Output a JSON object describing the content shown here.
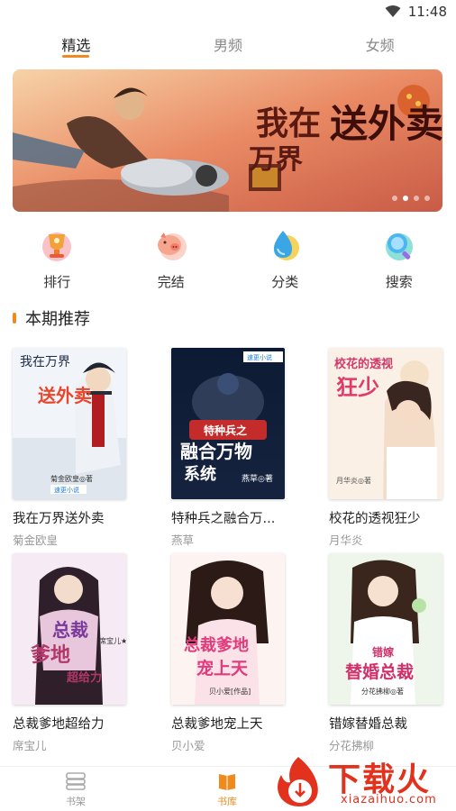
{
  "status_bar": {
    "time": "11:48"
  },
  "top_tabs": [
    {
      "label": "精选",
      "active": true
    },
    {
      "label": "男频",
      "active": false
    },
    {
      "label": "女频",
      "active": false
    }
  ],
  "banner": {
    "text_line1": "我在",
    "text_line2": "万界",
    "text_big": "送外卖",
    "dots": 4,
    "active_dot": 1
  },
  "quick_menu": [
    {
      "label": "排行",
      "icon": "trophy-icon"
    },
    {
      "label": "完结",
      "icon": "pig-icon"
    },
    {
      "label": "分类",
      "icon": "drop-icon"
    },
    {
      "label": "搜索",
      "icon": "magnifier-icon"
    }
  ],
  "section": {
    "title": "本期推荐"
  },
  "books": [
    {
      "title": "我在万界送外卖",
      "author": "菊金欧皇",
      "cover": {
        "line1": "我在万界",
        "line2": "送外卖",
        "footer": "菊金欧皇◎著",
        "badge": "速更小说"
      }
    },
    {
      "title": "特种兵之融合万...",
      "author": "燕草",
      "cover": {
        "line1": "特种兵之",
        "line2": "融合万物",
        "line3": "系统",
        "footer": "燕草◎著",
        "badge": "速更小说"
      }
    },
    {
      "title": "校花的透视狂少",
      "author": "月华炎",
      "cover": {
        "line1": "校花的透视",
        "line2": "狂少",
        "footer": "月华炎◎著"
      }
    },
    {
      "title": "总裁爹地超给力",
      "author": "席宝儿",
      "cover": {
        "line1": "总裁",
        "line2": "爹地",
        "line3": "超给力",
        "footer": "席宝儿★著"
      }
    },
    {
      "title": "总裁爹地宠上天",
      "author": "贝小爱",
      "cover": {
        "line1": "总裁爹地",
        "line2": "宠上天",
        "footer": "贝小爱[作品]"
      }
    },
    {
      "title": "错嫁替婚总裁",
      "author": "分花拂柳",
      "cover": {
        "line1": "错嫁",
        "line2": "替婚总裁",
        "footer": "分花拂柳◎著"
      }
    }
  ],
  "bottom_nav": [
    {
      "label": "书架",
      "icon": "bookshelf-icon",
      "active": false
    },
    {
      "label": "书库",
      "icon": "library-icon",
      "active": true
    },
    {
      "label": "",
      "icon": "",
      "active": false
    }
  ],
  "watermark": {
    "brand": "下载火",
    "domain": "xiazaihuo.com"
  },
  "colors": {
    "accent": "#f08a1c",
    "text": "#222222",
    "muted": "#999999",
    "watermark": "#e2311d"
  }
}
